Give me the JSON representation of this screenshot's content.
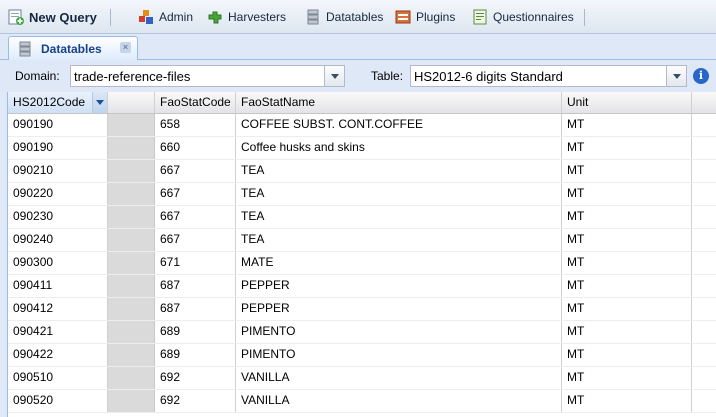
{
  "toolbar": {
    "items": [
      {
        "label": "New Query",
        "icon": "new-query-icon"
      },
      {
        "label": "Admin",
        "icon": "admin-icon"
      },
      {
        "label": "Harvesters",
        "icon": "harvesters-icon"
      },
      {
        "label": "Datatables",
        "icon": "datatables-icon"
      },
      {
        "label": "Plugins",
        "icon": "plugins-icon"
      },
      {
        "label": "Questionnaires",
        "icon": "questionnaires-icon"
      }
    ]
  },
  "tab": {
    "label": "Datatables",
    "close": "×"
  },
  "filter": {
    "domain_label": "Domain:",
    "domain_value": "trade-reference-files",
    "table_label": "Table:",
    "table_value": "HS2012-6 digits Standard",
    "info_glyph": "i"
  },
  "grid": {
    "columns": [
      "HS2012Code",
      "",
      "FaoStatCode",
      "FaoStatName",
      "Unit"
    ],
    "rows": [
      [
        "090190",
        "",
        "658",
        "COFFEE SUBST. CONT.COFFEE",
        "MT"
      ],
      [
        "090190",
        "",
        "660",
        "Coffee husks and skins",
        "MT"
      ],
      [
        "090210",
        "",
        "667",
        "TEA",
        "MT"
      ],
      [
        "090220",
        "",
        "667",
        "TEA",
        "MT"
      ],
      [
        "090230",
        "",
        "667",
        "TEA",
        "MT"
      ],
      [
        "090240",
        "",
        "667",
        "TEA",
        "MT"
      ],
      [
        "090300",
        "",
        "671",
        "MATE",
        "MT"
      ],
      [
        "090411",
        "",
        "687",
        "PEPPER",
        "MT"
      ],
      [
        "090412",
        "",
        "687",
        "PEPPER",
        "MT"
      ],
      [
        "090421",
        "",
        "689",
        "PIMENTO",
        "MT"
      ],
      [
        "090422",
        "",
        "689",
        "PIMENTO",
        "MT"
      ],
      [
        "090510",
        "",
        "692",
        "VANILLA",
        "MT"
      ],
      [
        "090520",
        "",
        "692",
        "VANILLA",
        "MT"
      ]
    ]
  },
  "colors": {
    "accent": "#15428b",
    "header_border": "#99bbe8",
    "blank_column": "#dadada"
  }
}
